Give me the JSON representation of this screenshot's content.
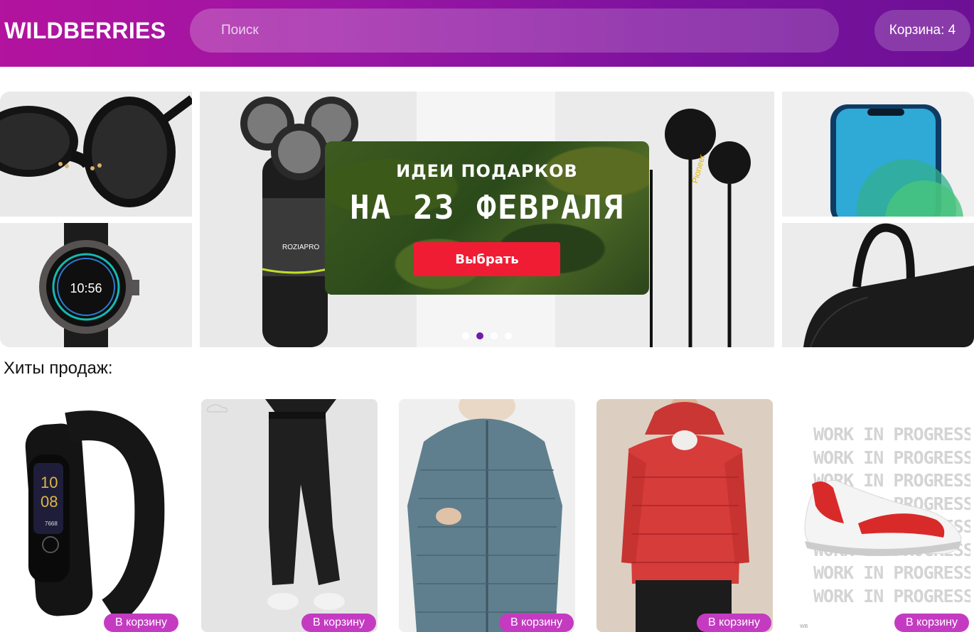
{
  "header": {
    "logo": "WILDBERRIES",
    "search_placeholder": "Поиск",
    "cart_label": "Корзина: 4"
  },
  "banner": {
    "promo_title": "ИДЕИ ПОДАРКОВ",
    "promo_subtitle": "НА 23 ФЕВРАЛЯ",
    "promo_button": "Выбрать",
    "watch_time": "10:56",
    "shaver_brand": "ROZIAPRO",
    "earphones_brand": "Pioneer",
    "slides_total": 4,
    "active_slide": 2
  },
  "hits": {
    "title": "Хиты продаж:",
    "products": [
      {
        "name": "fitness-band",
        "button": "В корзину",
        "screen_time_h": "10",
        "screen_time_m": "08",
        "steps": "7668"
      },
      {
        "name": "jogger-pants",
        "button": "В корзину"
      },
      {
        "name": "puffer-coat-blue",
        "button": "В корзину"
      },
      {
        "name": "puffer-jacket-red",
        "button": "В корзину"
      },
      {
        "name": "sneaker",
        "button": "В корзину",
        "wip_text": "WORK IN PROGRESS",
        "wip_footer": "WB"
      }
    ]
  },
  "colors": {
    "header_start": "#b3139e",
    "header_end": "#6d1096",
    "buy_button": "#c43bc2",
    "promo_button": "#f01c34",
    "active_dot": "#6a0fa0"
  }
}
